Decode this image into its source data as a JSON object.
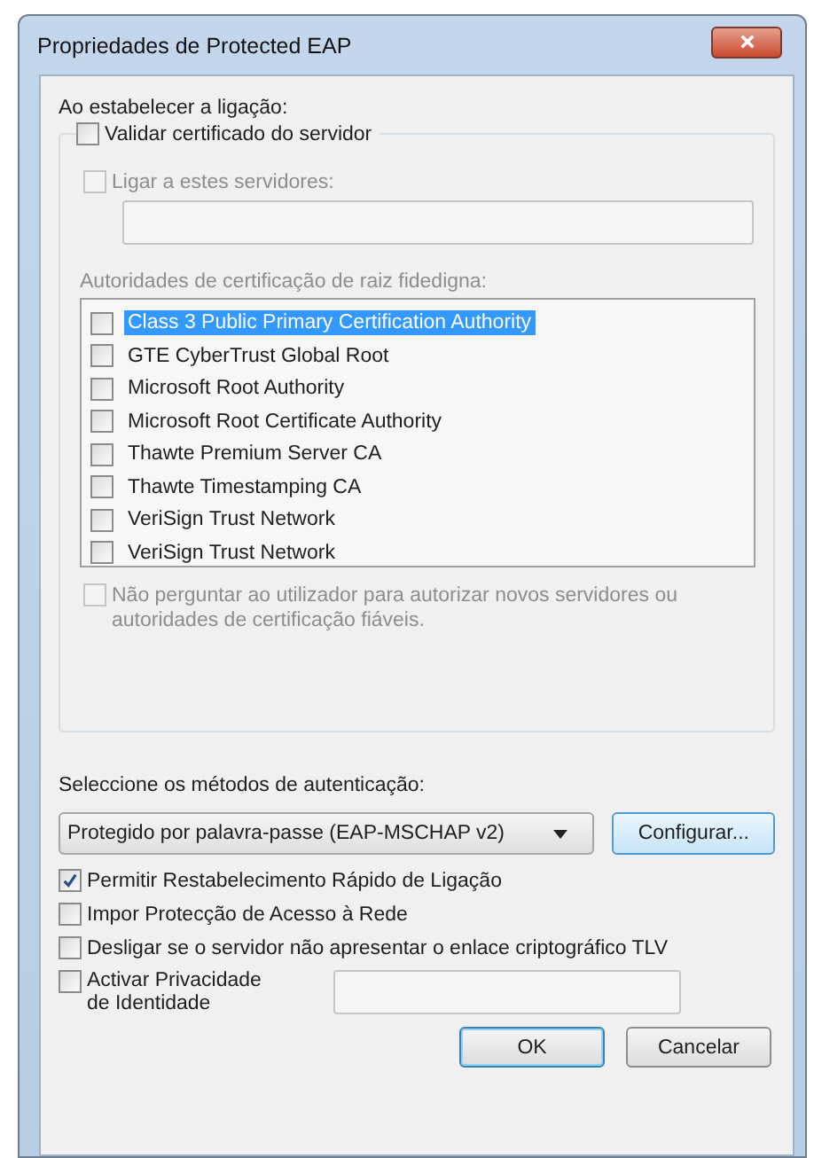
{
  "window": {
    "title": "Propriedades de Protected EAP"
  },
  "connection_heading": "Ao estabelecer a ligação:",
  "validate_certificate": {
    "label": "Validar certificado do servidor",
    "checked": false
  },
  "connect_to_servers": {
    "label": "Ligar a estes servidores:",
    "checked": false,
    "disabled": true
  },
  "root_ca": {
    "label": "Autoridades de certificação de raiz fidedigna:",
    "disabled": true,
    "items": [
      {
        "label": "Class 3 Public Primary Certification Authority",
        "checked": false,
        "selected": true
      },
      {
        "label": "GTE CyberTrust Global Root",
        "checked": false,
        "selected": false
      },
      {
        "label": "Microsoft Root Authority",
        "checked": false,
        "selected": false
      },
      {
        "label": "Microsoft Root Certificate Authority",
        "checked": false,
        "selected": false
      },
      {
        "label": "Thawte Premium Server CA",
        "checked": false,
        "selected": false
      },
      {
        "label": "Thawte Timestamping CA",
        "checked": false,
        "selected": false
      },
      {
        "label": "VeriSign Trust Network",
        "checked": false,
        "selected": false
      },
      {
        "label": "VeriSign Trust Network",
        "checked": false,
        "selected": false
      }
    ]
  },
  "no_prompt": {
    "label": "Não perguntar ao utilizador para autorizar novos servidores ou autoridades de certificação fiáveis.",
    "checked": false,
    "disabled": true
  },
  "auth_heading": "Seleccione os métodos de autenticação:",
  "auth_method": {
    "value": "Protegido por palavra-passe (EAP-MSCHAP v2)"
  },
  "configure_button": "Configurar...",
  "options": [
    {
      "label": "Permitir Restabelecimento Rápido de Ligação",
      "checked": true
    },
    {
      "label": "Impor Protecção de Acesso à Rede",
      "checked": false
    },
    {
      "label": "Desligar se o servidor não apresentar o enlace criptográfico TLV",
      "checked": false
    }
  ],
  "identity_privacy": {
    "label": "Activar Privacidade de Identidade",
    "checked": false
  },
  "buttons": [
    {
      "label": "OK",
      "default": true
    },
    {
      "label": "Cancelar",
      "default": false
    }
  ]
}
